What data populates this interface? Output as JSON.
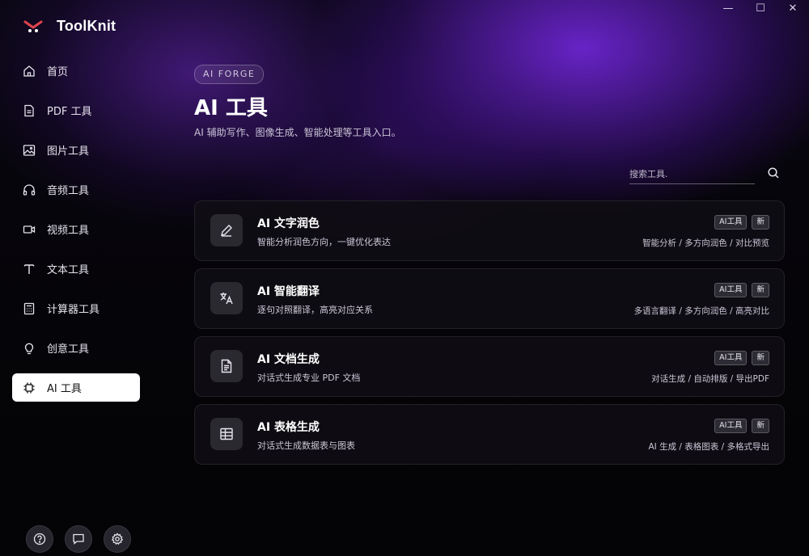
{
  "app": {
    "name": "ToolKnit"
  },
  "window_controls": {
    "minimize": "—",
    "maximize": "☐",
    "close": "✕"
  },
  "sidebar": {
    "items": [
      {
        "label": "首页",
        "icon": "home-icon",
        "active": false
      },
      {
        "label": "PDF 工具",
        "icon": "document-icon",
        "active": false
      },
      {
        "label": "图片工具",
        "icon": "image-icon",
        "active": false
      },
      {
        "label": "音频工具",
        "icon": "headphones-icon",
        "active": false
      },
      {
        "label": "视频工具",
        "icon": "video-icon",
        "active": false
      },
      {
        "label": "文本工具",
        "icon": "text-icon",
        "active": false
      },
      {
        "label": "计算器工具",
        "icon": "calculator-icon",
        "active": false
      },
      {
        "label": "创意工具",
        "icon": "lightbulb-icon",
        "active": false
      },
      {
        "label": "AI 工具",
        "icon": "chip-icon",
        "active": true
      }
    ],
    "bottom_icons": [
      "help-icon",
      "feedback-icon",
      "settings-icon"
    ]
  },
  "main": {
    "badge": "AI FORGE",
    "title": "AI 工具",
    "subtitle": "AI 辅助写作、图像生成、智能处理等工具入口。",
    "search": {
      "placeholder": "搜索工具.",
      "value": ""
    },
    "cards": [
      {
        "title": "AI 文字润色",
        "description": "智能分析润色方向，一键优化表达",
        "tags": [
          "AI工具",
          "新"
        ],
        "features": "智能分析 / 多方向润色 / 对比预览",
        "icon": "pen-icon"
      },
      {
        "title": "AI 智能翻译",
        "description": "逐句对照翻译，高亮对应关系",
        "tags": [
          "AI工具",
          "新"
        ],
        "features": "多语言翻译 / 多方向润色 / 高亮对比",
        "icon": "translate-icon"
      },
      {
        "title": "AI 文档生成",
        "description": "对话式生成专业 PDF 文档",
        "tags": [
          "AI工具",
          "新"
        ],
        "features": "对话生成 / 自动排版 / 导出PDF",
        "icon": "file-text-icon"
      },
      {
        "title": "AI 表格生成",
        "description": "对话式生成数据表与图表",
        "tags": [
          "AI工具",
          "新"
        ],
        "features": "AI 生成 / 表格图表 / 多格式导出",
        "icon": "table-icon"
      }
    ]
  },
  "colors": {
    "accent": "#7a2fe0",
    "background": "#060508",
    "card": "#100e14",
    "active_nav": "#ffffff"
  }
}
